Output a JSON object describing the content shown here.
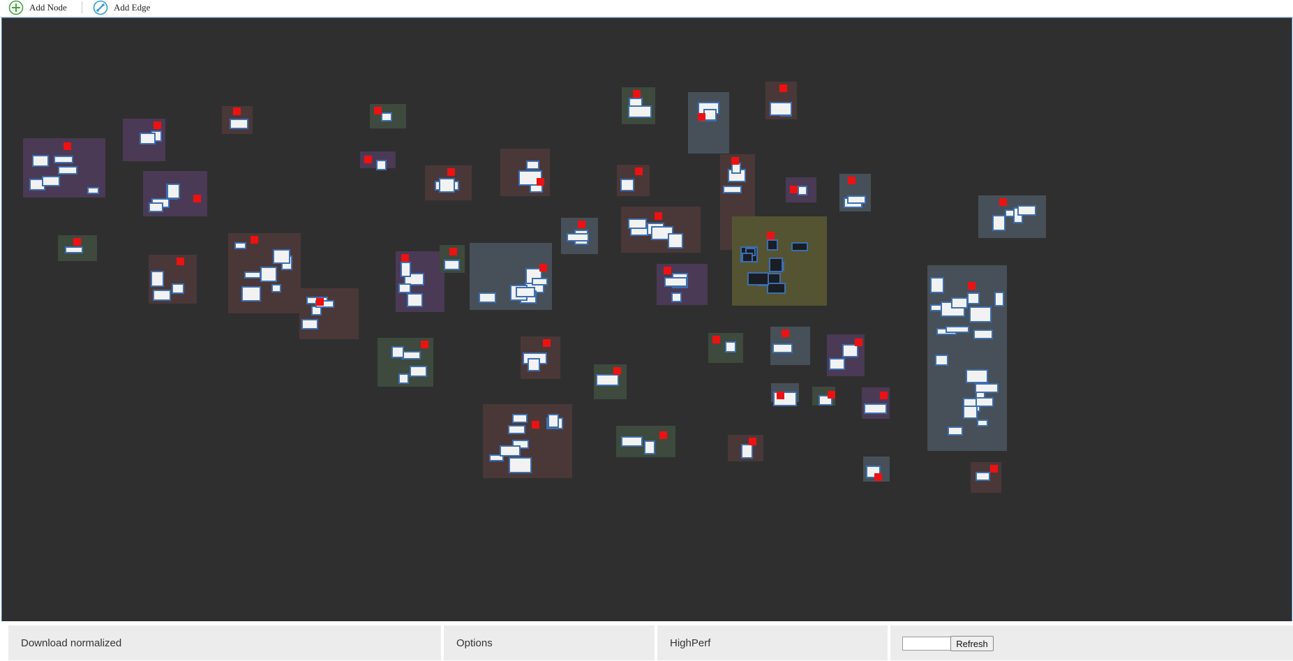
{
  "toolbar": {
    "add_node_label": "Add Node",
    "add_node_icon": "plus-circle-icon",
    "add_edge_label": "Add Edge",
    "add_edge_icon": "edge-link-icon"
  },
  "graph": {
    "background_color": "#2f2f2f",
    "node_color": "#3d6fb0",
    "marker_color": "#ee1111",
    "cluster_tints": [
      "#4a3a55",
      "#3d4a3d",
      "#4a3838",
      "#475058",
      "#545432",
      "#4e4030"
    ]
  },
  "bottom_bar": {
    "download_label": "Download normalized",
    "options_label": "Options",
    "highperf_label": "HighPerf",
    "refresh_input_value": "",
    "refresh_button_label": "Refresh"
  }
}
